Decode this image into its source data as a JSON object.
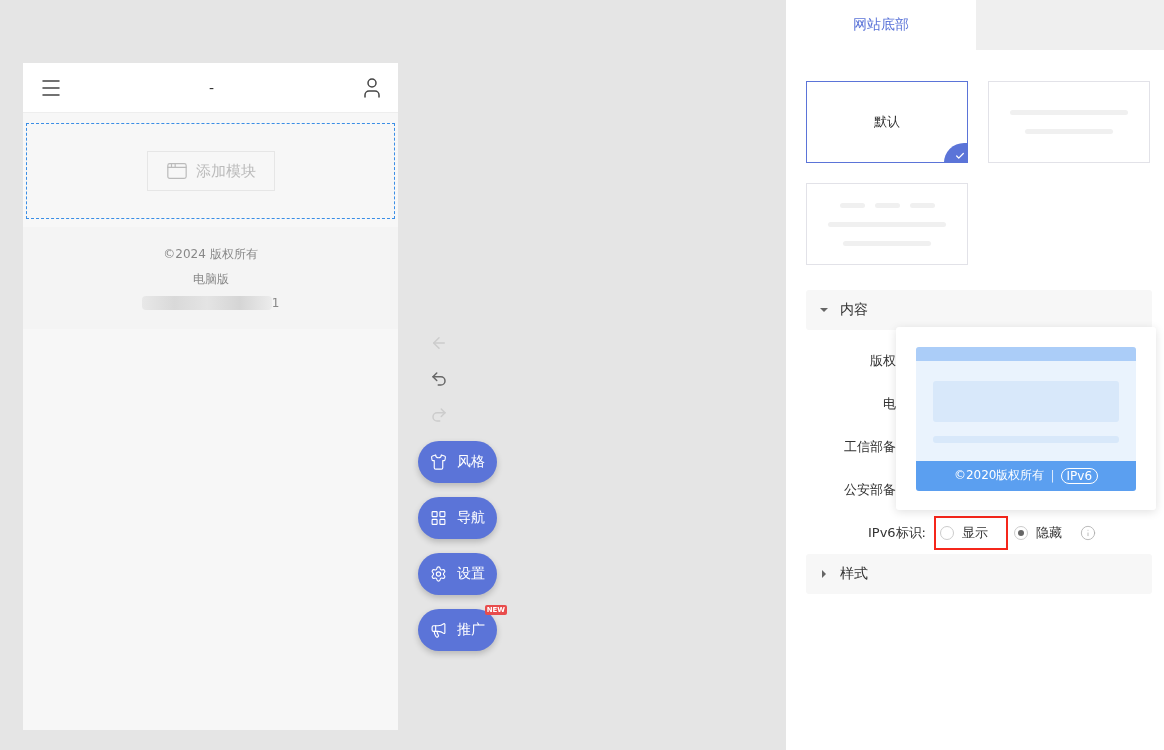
{
  "preview": {
    "title": "-",
    "add_module": "添加模块",
    "footer": {
      "copyright": "©2024 版权所有",
      "desktop_link": "电脑版",
      "blurred_tail": "1"
    }
  },
  "history": [
    {
      "kind": "back",
      "disabled": true
    },
    {
      "kind": "undo",
      "disabled": false
    },
    {
      "kind": "redo",
      "disabled": true
    }
  ],
  "fab_buttons": [
    {
      "kind": "style",
      "label": "风格"
    },
    {
      "kind": "nav",
      "label": "导航"
    },
    {
      "kind": "settings",
      "label": "设置"
    },
    {
      "kind": "promote",
      "label": "推广",
      "badge": "NEW"
    }
  ],
  "panel": {
    "tabs": [
      {
        "label": "网站底部",
        "selected": true
      }
    ],
    "templates": [
      {
        "kind": "text",
        "label": "默认",
        "selected": true
      },
      {
        "kind": "lines",
        "selected": false
      },
      {
        "kind": "wide",
        "selected": false
      }
    ],
    "sections": [
      {
        "title": "内容",
        "expanded": true,
        "rows": [
          {
            "kind": "covered",
            "label": "版权"
          },
          {
            "kind": "covered",
            "label": "电"
          },
          {
            "kind": "covered",
            "label": "工信部备"
          },
          {
            "kind": "covered",
            "label": "公安部备"
          },
          {
            "kind": "radio",
            "label": "IPv6标识:",
            "options": [
              {
                "label": "显示",
                "selected": false,
                "highlighted": true
              },
              {
                "label": "隐藏",
                "selected": true,
                "highlighted": false
              }
            ]
          }
        ]
      },
      {
        "title": "样式",
        "expanded": false
      }
    ],
    "popover": {
      "copyright": "©2020版权所有",
      "separator": "|",
      "badge": "IPv6"
    }
  }
}
